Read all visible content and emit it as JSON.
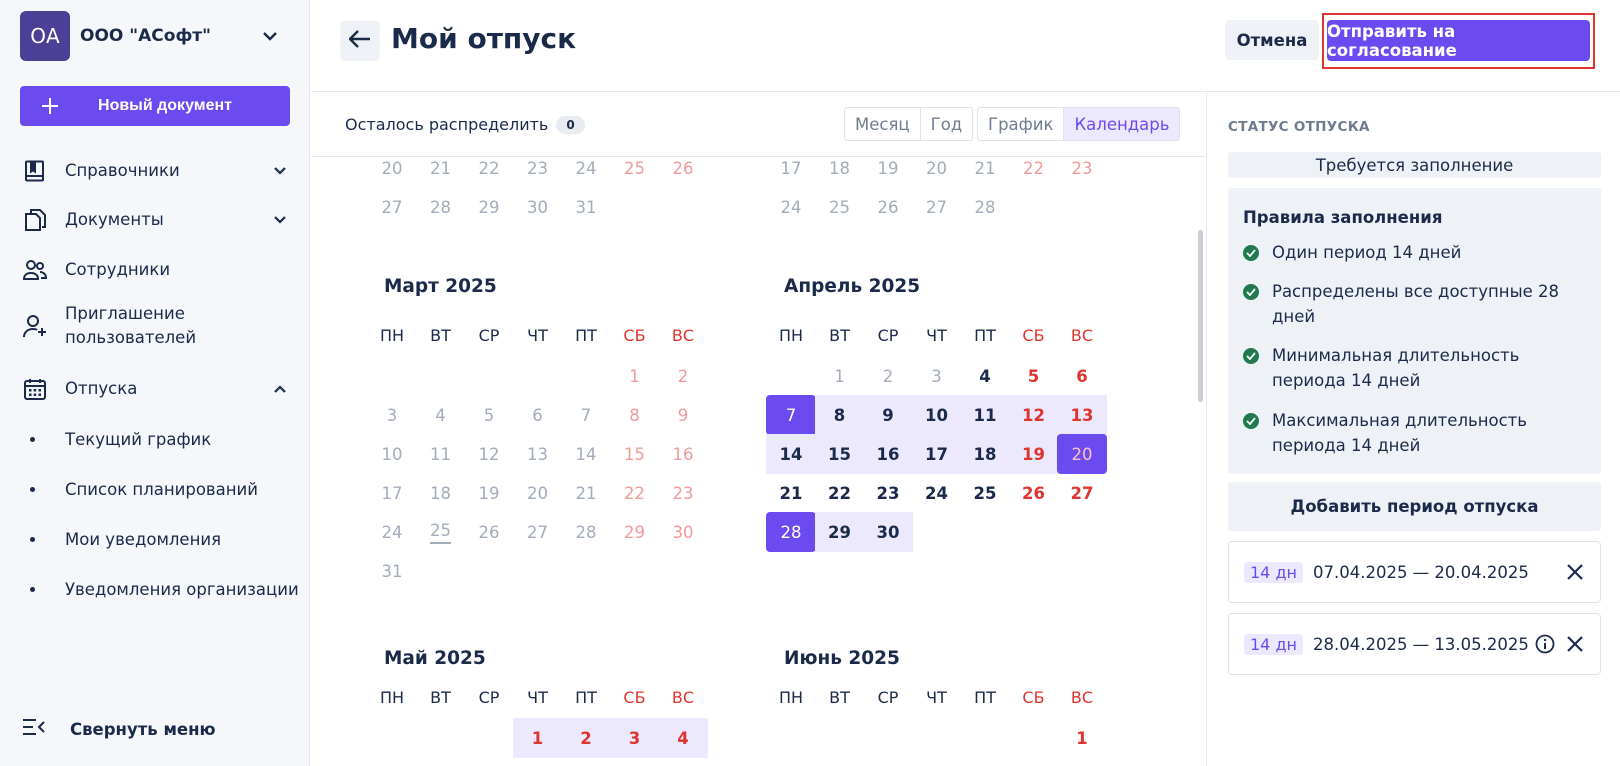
{
  "org": {
    "initials": "ОА",
    "name": "ООО \"АСофт\""
  },
  "sidebar": {
    "new_doc": "Новый документ",
    "items": [
      {
        "label": "Справочники"
      },
      {
        "label": "Документы"
      },
      {
        "label": "Сотрудники"
      },
      {
        "label": "Приглашение пользователей"
      },
      {
        "label": "Отпуска"
      }
    ],
    "sub_items": [
      "Текущий график",
      "Список планирований",
      "Мои уведомления",
      "Уведомления организации"
    ],
    "collapse": "Свернуть меню"
  },
  "header": {
    "title": "Мой отпуск",
    "cancel": "Отмена",
    "submit": "Отправить на согласование"
  },
  "toolbar": {
    "remain_label": "Осталось распределить",
    "remain_value": "0",
    "period_tabs": [
      "Месяц",
      "Год"
    ],
    "view_tabs": [
      "График",
      "Календарь"
    ],
    "active_view": "Календарь"
  },
  "weekdays": [
    "ПН",
    "ВТ",
    "СР",
    "ЧТ",
    "ПТ",
    "СБ",
    "ВС"
  ],
  "months": {
    "mar": "Март 2025",
    "apr": "Апрель 2025",
    "may": "Май 2025",
    "jun": "Июнь 2025"
  },
  "panel": {
    "heading": "СТАТУС ОТПУСКА",
    "status": "Требуется заполнение",
    "rules_title": "Правила заполнения",
    "rules": [
      "Один период 14 дней",
      "Распределены все доступные 28 дней",
      "Минимальная длительность периода 14 дней",
      "Максимальная длительность периода 14 дней"
    ],
    "add_period": "Добавить период отпуска",
    "periods": [
      {
        "days": "14 дн",
        "range": "07.04.2025 — 20.04.2025"
      },
      {
        "days": "14 дн",
        "range": "28.04.2025 — 13.05.2025"
      }
    ]
  },
  "colors": {
    "accent": "#6b4bf0",
    "weekend": "#e0342f",
    "range": "#ece8fd",
    "ok": "#1f7a4d"
  }
}
